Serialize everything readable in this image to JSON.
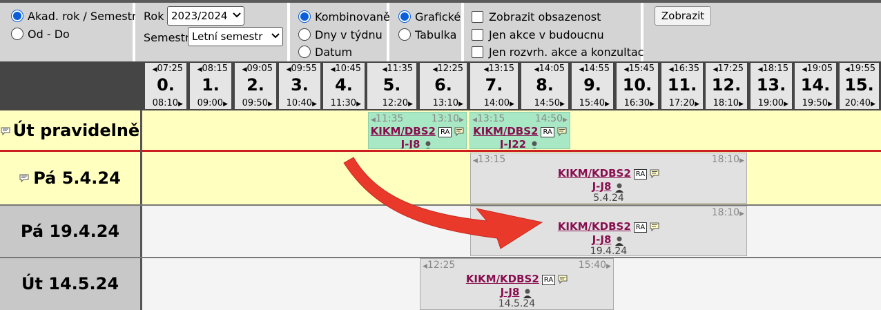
{
  "filters": {
    "period": [
      {
        "label": "Akad. rok / Semestr",
        "checked": true
      },
      {
        "label": "Od - Do",
        "checked": false
      }
    ],
    "year_label": "Rok",
    "year_value": "2023/2024",
    "semester_label": "Semestr",
    "semester_value": "Letní semestr",
    "mode": [
      {
        "label": "Kombinovaně",
        "checked": true
      },
      {
        "label": "Dny v týdnu",
        "checked": false
      },
      {
        "label": "Datum",
        "checked": false
      }
    ],
    "view": [
      {
        "label": "Grafické",
        "checked": true
      },
      {
        "label": "Tabulka",
        "checked": false
      }
    ],
    "checkboxes": [
      {
        "label": "Zobrazit obsazenost",
        "checked": false
      },
      {
        "label": "Jen akce v budoucnu",
        "checked": false
      },
      {
        "label": "Jen rozvrh. akce a konzultace",
        "checked": false
      }
    ],
    "show_button": "Zobrazit"
  },
  "slots": [
    {
      "start": "07:25",
      "num": "0.",
      "end": "08:10"
    },
    {
      "start": "08:15",
      "num": "1.",
      "end": "09:00"
    },
    {
      "start": "09:05",
      "num": "2.",
      "end": "09:50"
    },
    {
      "start": "09:55",
      "num": "3.",
      "end": "10:40"
    },
    {
      "start": "10:45",
      "num": "4.",
      "end": "11:30"
    },
    {
      "start": "11:35",
      "num": "5.",
      "end": "12:20"
    },
    {
      "start": "12:25",
      "num": "6.",
      "end": "13:10"
    },
    {
      "start": "13:15",
      "num": "7.",
      "end": "14:00"
    },
    {
      "start": "14:05",
      "num": "8.",
      "end": "14:50"
    },
    {
      "start": "14:55",
      "num": "9.",
      "end": "15:40"
    },
    {
      "start": "15:45",
      "num": "10.",
      "end": "16:30"
    },
    {
      "start": "16:35",
      "num": "11.",
      "end": "17:20"
    },
    {
      "start": "17:25",
      "num": "12.",
      "end": "18:10"
    },
    {
      "start": "18:15",
      "num": "13.",
      "end": "19:00"
    },
    {
      "start": "19:05",
      "num": "14.",
      "end": "19:50"
    },
    {
      "start": "19:55",
      "num": "15.",
      "end": "20:40"
    }
  ],
  "rows": [
    {
      "label": "Út pravidelně",
      "has_note": true
    },
    {
      "label": "Pá 5.4.24",
      "has_note": true
    },
    {
      "label": "Pá 19.4.24",
      "has_note": false
    },
    {
      "label": "Út 14.5.24",
      "has_note": false
    }
  ],
  "events": {
    "e1": {
      "start": "11:35",
      "end": "13:10",
      "code": "KIKM/DBS2",
      "ra": "RA",
      "room": "J-J8"
    },
    "e2": {
      "start": "13:15",
      "end": "14:50",
      "code": "KIKM/DBS2",
      "ra": "RA",
      "room": "J-J22"
    },
    "e3": {
      "start": "13:15",
      "end": "18:10",
      "code": "KIKM/KDBS2",
      "ra": "RA",
      "room": "J-J8",
      "date": "5.4.24"
    },
    "e4": {
      "start": "",
      "end": "18:10",
      "code": "KIKM/KDBS2",
      "ra": "RA",
      "room": "J-J8",
      "date": "19.4.24"
    },
    "e5": {
      "start": "12:25",
      "end": "15:40",
      "code": "KIKM/KDBS2",
      "ra": "RA",
      "room": "J-J8",
      "date": "14.5.24"
    }
  },
  "colors": {
    "regular_row": "#ffffc0",
    "event_green": "#a8e8c4",
    "event_gray": "#e1e1e1",
    "arrow": "#e8392b",
    "link": "#880e4f"
  }
}
